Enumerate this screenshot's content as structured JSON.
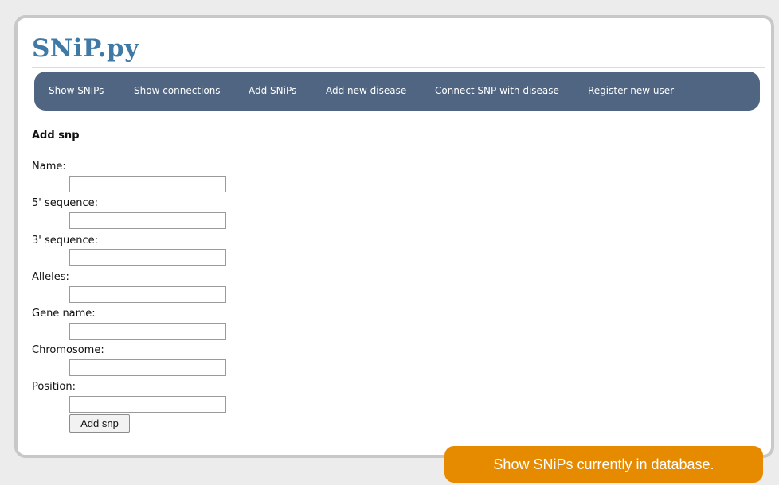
{
  "site": {
    "title": "SNiP.py"
  },
  "nav": {
    "items": [
      {
        "label": "Show SNiPs"
      },
      {
        "label": "Show connections"
      },
      {
        "label": "Add SNiPs"
      },
      {
        "label": "Add new disease"
      },
      {
        "label": "Connect SNP with disease"
      },
      {
        "label": "Register new user"
      }
    ]
  },
  "form": {
    "heading": "Add snp",
    "fields": [
      {
        "label": "Name:",
        "value": ""
      },
      {
        "label": "5' sequence:",
        "value": ""
      },
      {
        "label": "3' sequence:",
        "value": ""
      },
      {
        "label": "Alleles:",
        "value": ""
      },
      {
        "label": "Gene name:",
        "value": ""
      },
      {
        "label": "Chromosome:",
        "value": ""
      },
      {
        "label": "Position:",
        "value": ""
      }
    ],
    "submit_label": "Add snp"
  },
  "footer_button": {
    "label": "Show SNiPs currently in database."
  },
  "colors": {
    "title": "#3f7aa6",
    "navbar": "#4f6582",
    "accent_button": "#e68a00"
  }
}
